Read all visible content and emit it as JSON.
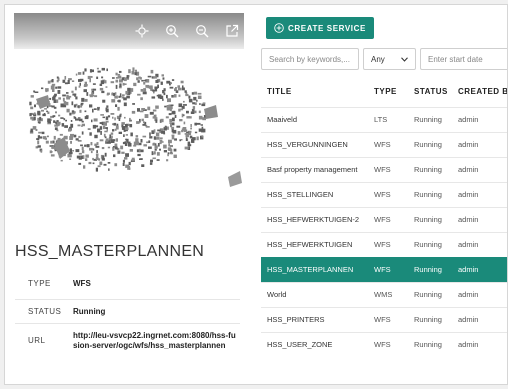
{
  "map": {
    "tools": [
      {
        "icon": "crosshair-icon"
      },
      {
        "icon": "zoom-in-icon"
      },
      {
        "icon": "zoom-out-icon"
      },
      {
        "icon": "open-external-icon"
      }
    ]
  },
  "detail": {
    "title": "HSS_MASTERPLANNEN",
    "props": [
      {
        "key": "TYPE",
        "value": "WFS"
      },
      {
        "key": "STATUS",
        "value": "Running"
      },
      {
        "key": "URL",
        "value": "http://leu-vsvcp22.ingrnet.com:8080/hss-fusion-server/ogc/wfs/hss_masterplannen"
      }
    ]
  },
  "toolbar": {
    "create_label": "CREATE SERVICE",
    "search_placeholder": "Search by keywords,...",
    "type_filter": "Any",
    "date_placeholder": "Enter start date"
  },
  "table": {
    "headers": [
      "TITLE",
      "TYPE",
      "STATUS",
      "CREATED BY"
    ],
    "rows": [
      {
        "title": "Maaiveld",
        "type": "LTS",
        "status": "Running",
        "created_by": "admin"
      },
      {
        "title": "HSS_VERGUNNINGEN",
        "type": "WFS",
        "status": "Running",
        "created_by": "admin"
      },
      {
        "title": "Basf property management",
        "type": "WFS",
        "status": "Running",
        "created_by": "admin"
      },
      {
        "title": "HSS_STELLINGEN",
        "type": "WFS",
        "status": "Running",
        "created_by": "admin"
      },
      {
        "title": "HSS_HEFWERKTUIGEN-2",
        "type": "WFS",
        "status": "Running",
        "created_by": "admin"
      },
      {
        "title": "HSS_HEFWERKTUIGEN",
        "type": "WFS",
        "status": "Running",
        "created_by": "admin"
      },
      {
        "title": "HSS_MASTERPLANNEN",
        "type": "WFS",
        "status": "Running",
        "created_by": "admin",
        "selected": true
      },
      {
        "title": "World",
        "type": "WMS",
        "status": "Running",
        "created_by": "admin"
      },
      {
        "title": "HSS_PRINTERS",
        "type": "WFS",
        "status": "Running",
        "created_by": "admin"
      },
      {
        "title": "HSS_USER_ZONE",
        "type": "WFS",
        "status": "Running",
        "created_by": "admin"
      }
    ]
  },
  "colors": {
    "accent": "#1a8a7a",
    "selected_text": "#ffffff"
  }
}
